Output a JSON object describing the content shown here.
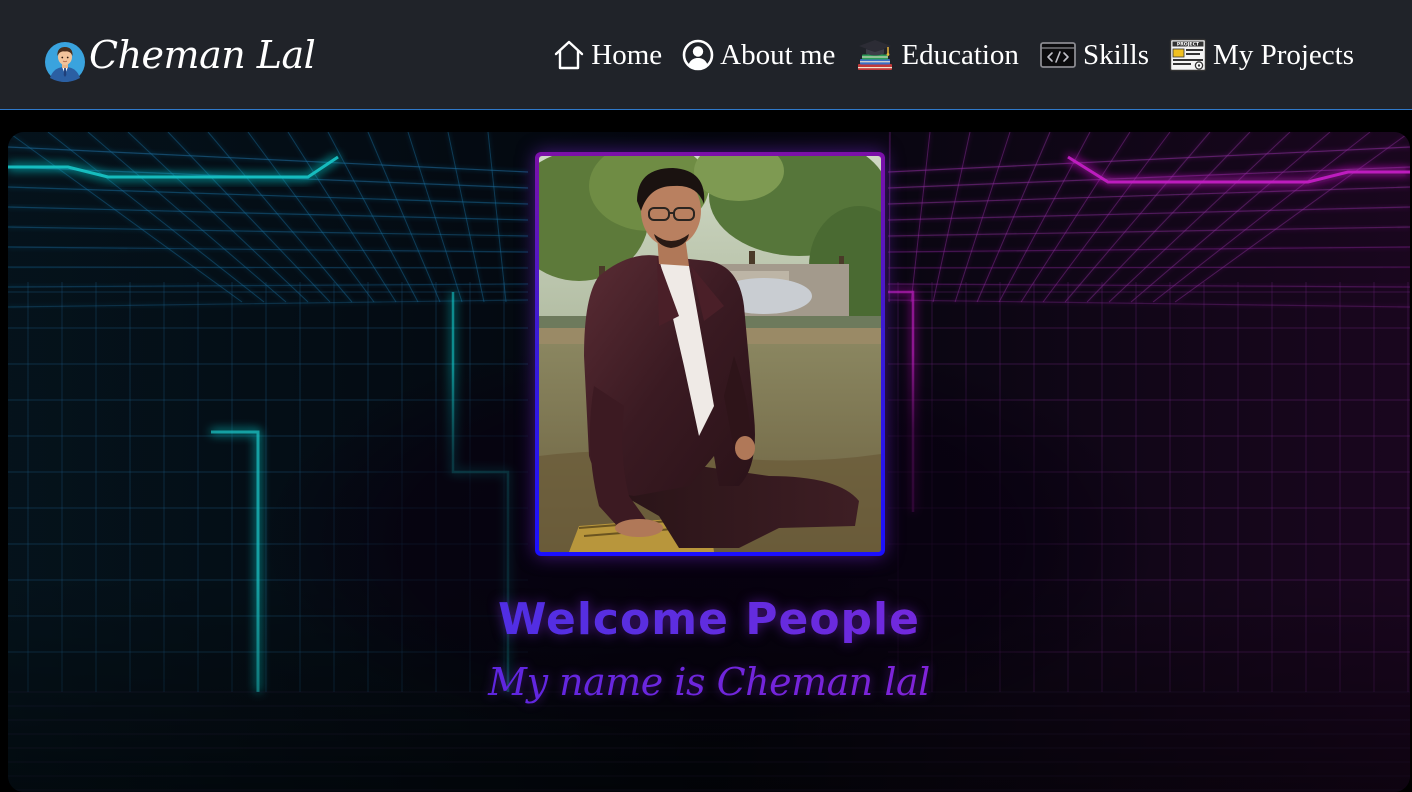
{
  "brand": {
    "name": "Cheman Lal",
    "avatar_icon": "man-avatar-icon"
  },
  "nav": {
    "items": [
      {
        "label": "Home",
        "icon": "home-icon"
      },
      {
        "label": "About me",
        "icon": "user-circle-icon"
      },
      {
        "label": "Education",
        "icon": "graduation-cap-icon"
      },
      {
        "label": "Skills",
        "icon": "code-icon"
      },
      {
        "label": "My Projects",
        "icon": "project-icon"
      }
    ]
  },
  "hero": {
    "title": "Welcome People",
    "subtitle": "My name is Cheman lal"
  },
  "colors": {
    "navbar_bg": "#202329",
    "navbar_border": "#2f78c8",
    "nav_text": "#ffffff",
    "frame_gradient_top": "#7c10a8",
    "frame_gradient_bottom": "#1b10ff",
    "title_gradient_start": "#2f2cf2",
    "title_gradient_end": "#9d1fd8",
    "neon_cyan": "#19c6c8",
    "neon_magenta": "#c81ec8"
  }
}
